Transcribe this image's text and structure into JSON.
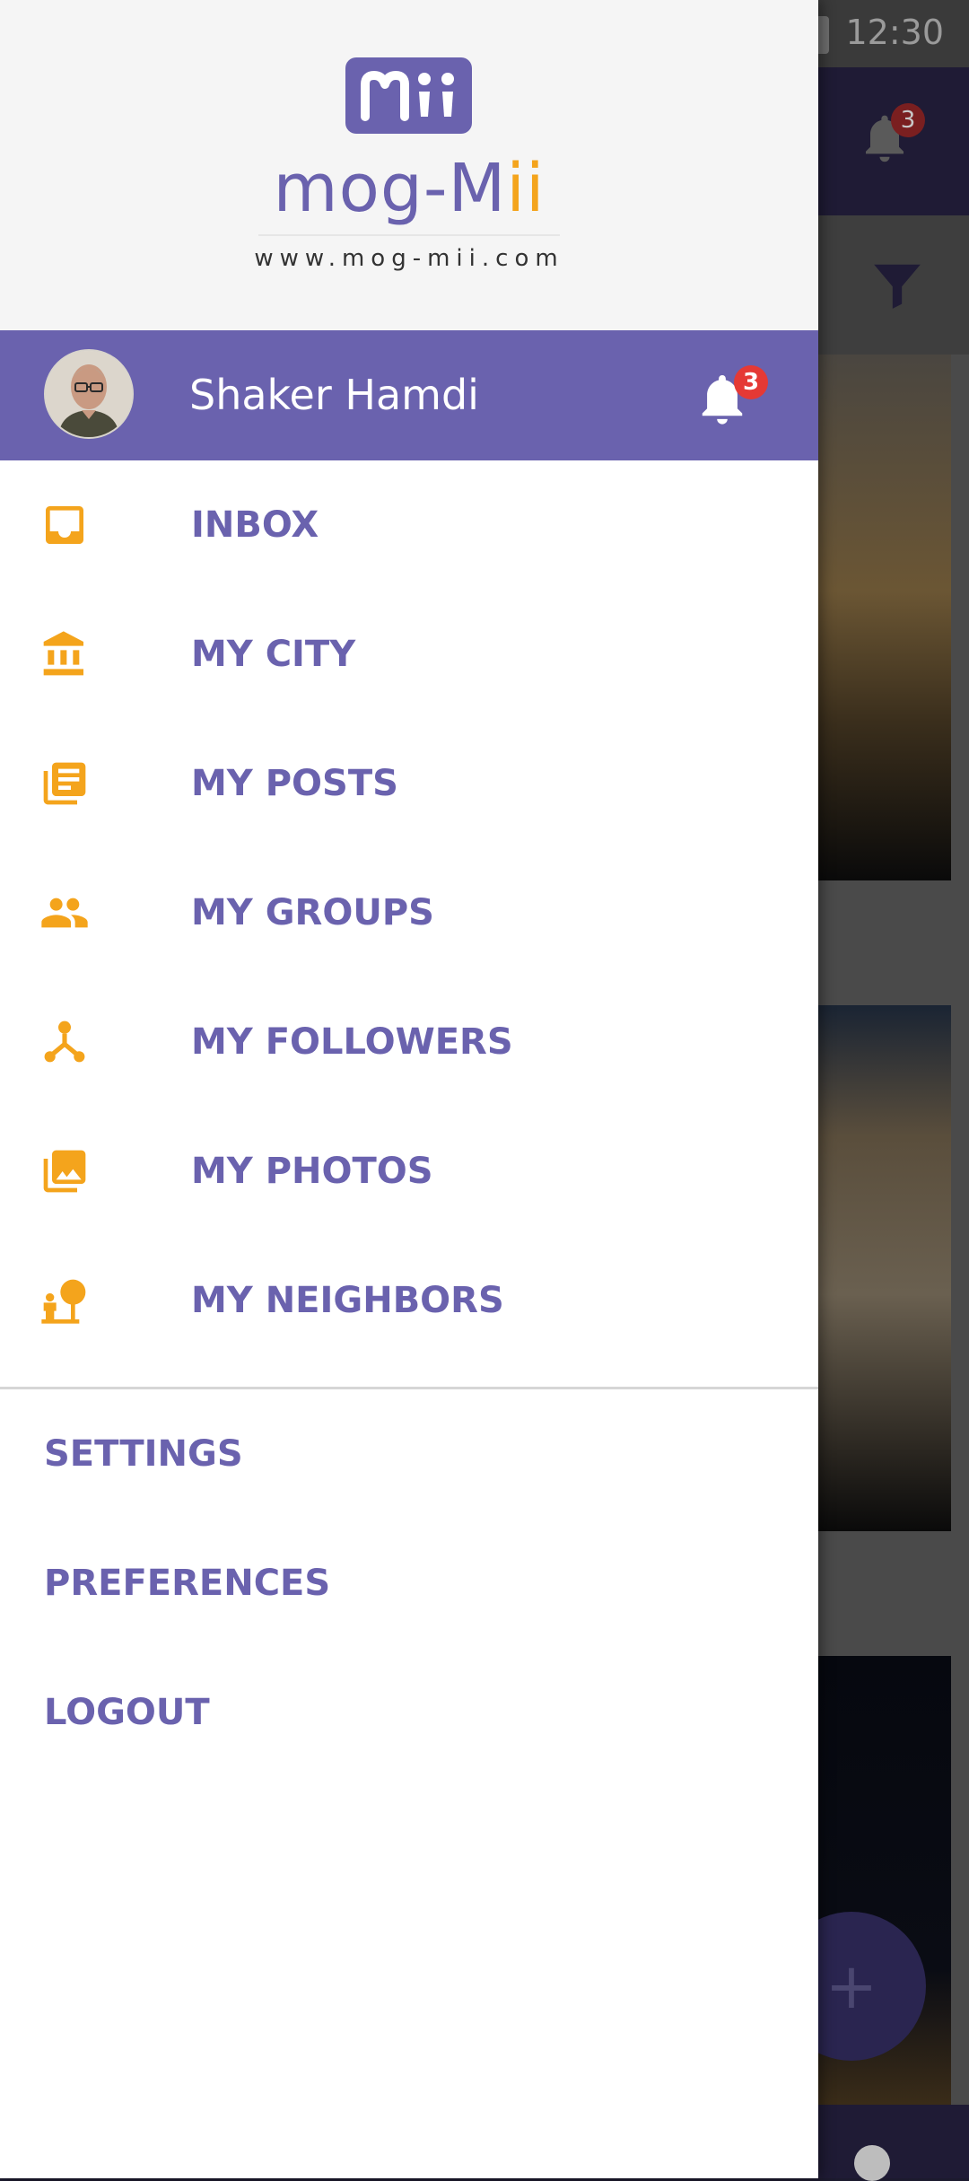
{
  "status_bar": {
    "time": "12:30"
  },
  "background": {
    "notification_count": "3",
    "fab_label": "+"
  },
  "brand": {
    "logo_mark_text": "Mii",
    "logo_word_part1": "mog",
    "logo_word_part2": "-M",
    "logo_word_part3": "ii",
    "website": "www.mog-mii.com",
    "colors": {
      "primary": "#6a62ae",
      "accent": "#f4a41c"
    }
  },
  "profile": {
    "name": "Shaker Hamdi",
    "avatar_icon": "user-avatar",
    "notification_count": "3"
  },
  "menu": [
    {
      "label": "INBOX",
      "icon": "inbox-icon"
    },
    {
      "label": "MY CITY",
      "icon": "city-building-icon"
    },
    {
      "label": "MY POSTS",
      "icon": "posts-icon"
    },
    {
      "label": "MY GROUPS",
      "icon": "groups-icon"
    },
    {
      "label": "MY FOLLOWERS",
      "icon": "followers-network-icon"
    },
    {
      "label": "MY PHOTOS",
      "icon": "photos-icon"
    },
    {
      "label": "MY NEIGHBORS",
      "icon": "neighbors-icon"
    }
  ],
  "secondary_menu": [
    {
      "label": "SETTINGS"
    },
    {
      "label": "PREFERENCES"
    },
    {
      "label": "LOGOUT"
    }
  ]
}
